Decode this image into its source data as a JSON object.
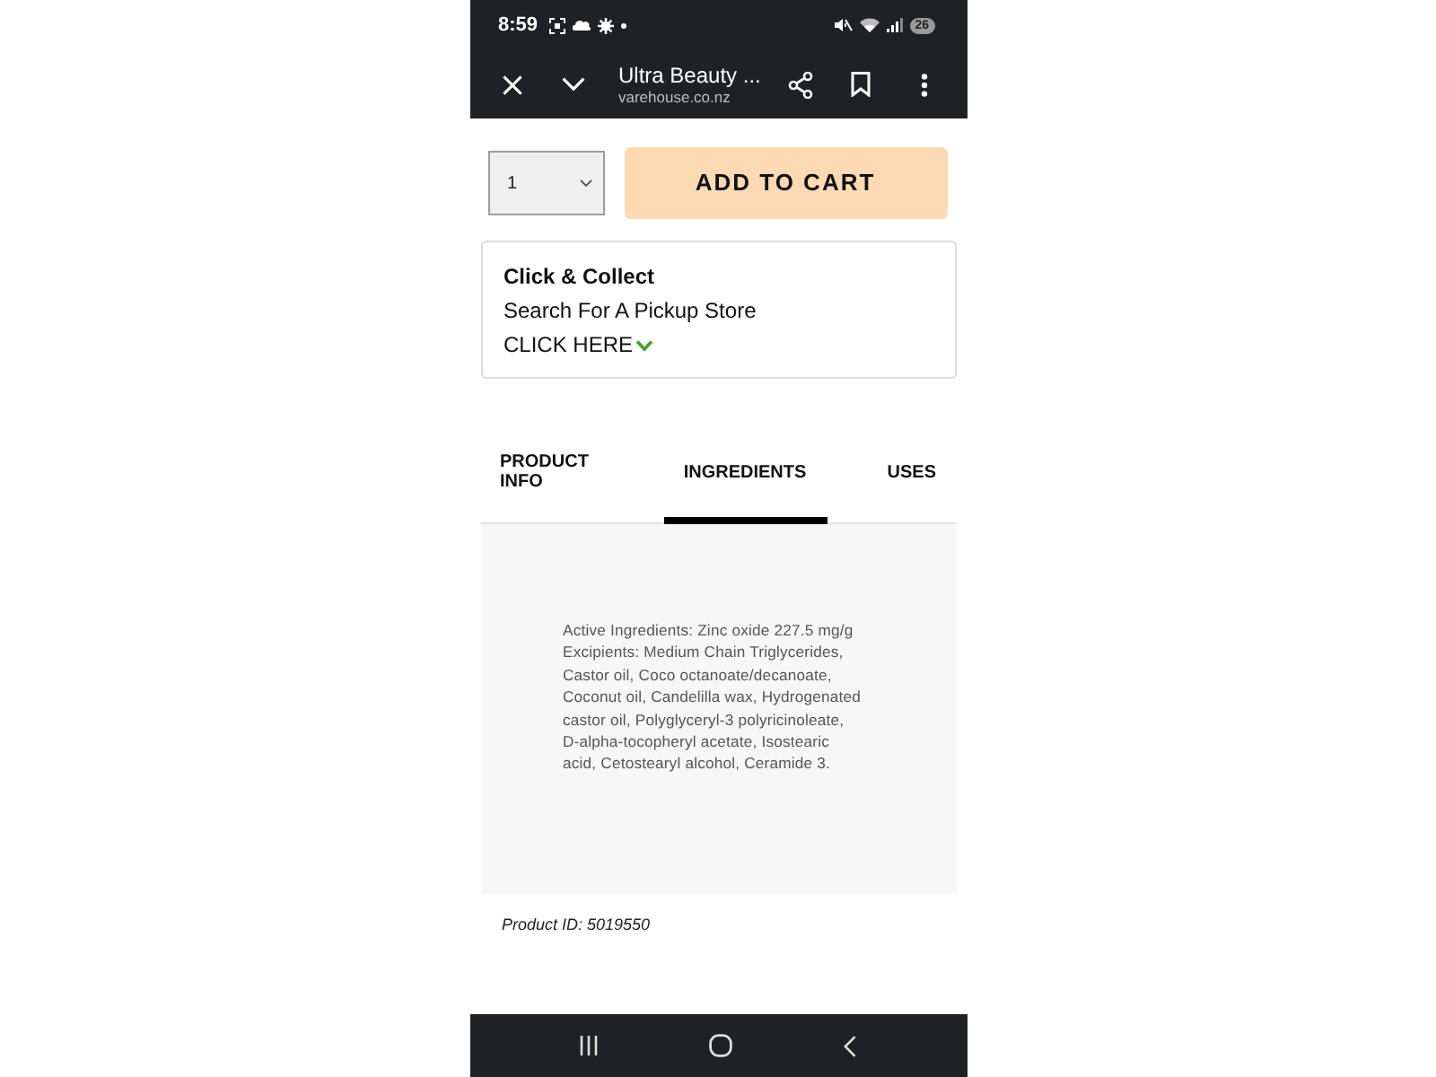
{
  "status_bar": {
    "time": "8:59",
    "battery": "26"
  },
  "browser_toolbar": {
    "title": "Ultra Beauty ...",
    "url": "varehouse.co.nz"
  },
  "quantity": {
    "value": "1"
  },
  "add_to_cart": {
    "label": "ADD TO CART"
  },
  "click_collect": {
    "title": "Click & Collect",
    "subtitle": "Search For A Pickup Store",
    "link": "CLICK HERE"
  },
  "tabs": [
    {
      "label": "PRODUCT INFO",
      "selected": false
    },
    {
      "label": "INGREDIENTS",
      "selected": true
    },
    {
      "label": "USES",
      "selected": false
    }
  ],
  "ingredients": {
    "lines": [
      "Active Ingredients: Zinc oxide 227.5 mg/g",
      "Excipients: Medium Chain Triglycerides,",
      "Castor oil, Coco octanoate/decanoate,",
      "Coconut oil, Candelilla wax, Hydrogenated",
      "castor oil, Polyglyceryl-3 polyricinoleate,",
      "D-alpha-tocopheryl acetate, Isostearic",
      "acid, Cetostearyl alcohol, Ceramide 3."
    ]
  },
  "product_id": "Product ID: 5019550"
}
